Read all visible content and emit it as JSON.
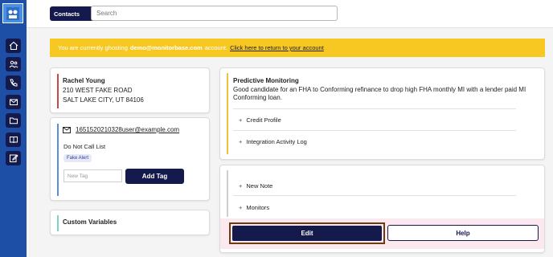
{
  "header": {
    "contacts_label": "Contacts",
    "search_placeholder": "Search"
  },
  "banner": {
    "prefix": "You are currently ghosting",
    "account": "demo@monitorbase.com",
    "suffix": "account.",
    "link": "Click here to return to your account"
  },
  "contact": {
    "name": "Rachel Young",
    "street": "210 WEST FAKE ROAD",
    "city": "SALT LAKE CITY, UT 84106",
    "email": "1651520210328user@example.com",
    "do_not_call": "Do Not Call List",
    "tag_chip": "Fake Alert",
    "new_tag_placeholder": "New Tag",
    "add_tag_label": "Add Tag",
    "custom_variables_label": "Custom Variables"
  },
  "predictive": {
    "title": "Predictive Monitoring",
    "body": "Good candidate for an FHA to Conforming refinance to drop high FHA monthly MI with a lender paid MI Conforming loan.",
    "items": [
      "Credit Profile",
      "Integration Activity Log"
    ]
  },
  "notes": {
    "items": [
      "New Note",
      "Monitors"
    ],
    "edit_label": "Edit",
    "help_label": "Help"
  },
  "plus_glyph": "+",
  "colors": {
    "navy": "#151a4d",
    "sidebar_blue": "#1d4fa6",
    "banner_yellow": "#f7c821",
    "address_bar": "#c84848",
    "contact_bar": "#5b8ed8",
    "vars_bar": "#7fd2cc",
    "pred_bar": "#e8c43a",
    "notes_bar": "#cfcfcf"
  },
  "icons": [
    "logo-icon",
    "home-icon",
    "people-icon",
    "phone-icon",
    "mail-icon",
    "folder-icon",
    "book-icon",
    "edit-note-icon",
    "chevron-down-icon"
  ]
}
